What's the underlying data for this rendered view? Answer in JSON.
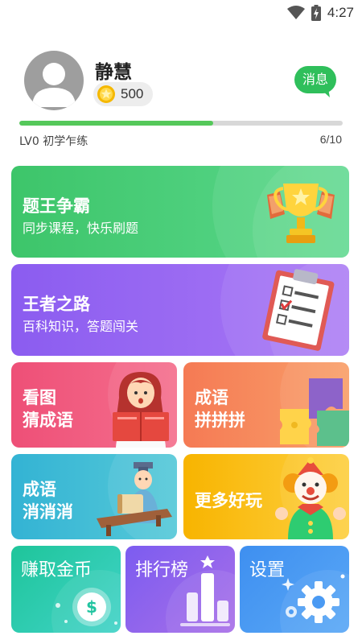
{
  "status_bar": {
    "time": "4:27",
    "icons": [
      "wifi-icon",
      "battery-charging-icon"
    ]
  },
  "profile": {
    "name": "静慧",
    "coins": "500",
    "message_button": "消息",
    "level": "LV0 初学乍练",
    "level_progress": "6/10",
    "progress_fraction": 0.6
  },
  "cards": {
    "c1": {
      "title": "题王争霸",
      "subtitle": "同步课程，快乐刷题",
      "icon": "trophy-icon"
    },
    "c2": {
      "title": "王者之路",
      "subtitle": "百科知识，答题闯关",
      "icon": "clipboard-checklist-icon"
    },
    "c3": {
      "line1": "看图",
      "line2": "猜成语",
      "icon": "girl-reading-icon"
    },
    "c4": {
      "line1": "成语",
      "line2": "拼拼拼",
      "icon": "puzzle-icon"
    },
    "c5": {
      "line1": "成语",
      "line2": "消消消",
      "icon": "scholar-icon"
    },
    "c6": {
      "title": "更多好玩",
      "icon": "clown-icon"
    },
    "c7": {
      "title": "赚取金币",
      "icon": "dollar-coin-icon"
    },
    "c8": {
      "title": "排行榜",
      "icon": "ranking-bars-icon"
    },
    "c9": {
      "title": "设置",
      "icon": "gear-icon"
    }
  },
  "colors": {
    "green_card": "#3dc56a",
    "purple_card": "#8b5cf0",
    "pink_card": "#ee4f77",
    "orange_card": "#f57a54",
    "blue_card": "#33b3d4",
    "yellow_card": "#f8b400",
    "teal_card": "#1ec59a",
    "violet_card": "#7c5cf0",
    "sky_card": "#3e8ff0",
    "progress_fill": "#55c85a",
    "message_green": "#2fbf5b"
  }
}
